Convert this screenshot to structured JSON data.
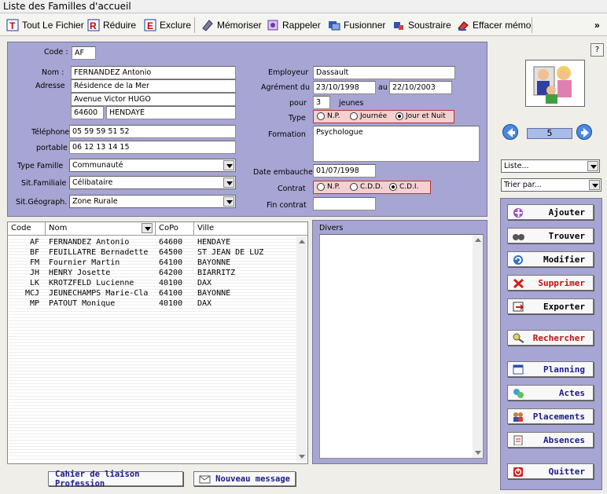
{
  "window": {
    "title": "Liste des Familles d'accueil"
  },
  "toolbar": {
    "items": [
      {
        "label": "Tout Le Fichier",
        "icon": "all-file-icon"
      },
      {
        "label": "Réduire",
        "icon": "reduce-icon"
      },
      {
        "label": "Exclure",
        "icon": "exclude-icon"
      },
      {
        "label": "Mémoriser",
        "icon": "memorize-icon"
      },
      {
        "label": "Rappeler",
        "icon": "recall-icon"
      },
      {
        "label": "Fusionner",
        "icon": "merge-icon"
      },
      {
        "label": "Soustraire",
        "icon": "subtract-icon"
      },
      {
        "label": "Effacer mémo",
        "icon": "erase-memo-icon"
      }
    ],
    "overflow": "»"
  },
  "form": {
    "code_label": "Code :",
    "code": "AF",
    "nom_label": "Nom :",
    "nom": "FERNANDEZ Antonio",
    "adresse_label": "Adresse",
    "adresse1": "Résidence de la Mer",
    "adresse2": "Avenue Victor HUGO",
    "cp": "64600",
    "ville": "HENDAYE",
    "telephone_label": "Téléphone",
    "telephone": "05 59 59 51 52",
    "portable_label": "portable",
    "portable": "06 12 13 14 15",
    "type_famille_label": "Type Famille",
    "type_famille": "Communauté",
    "sit_familiale_label": "Sit.Familiale",
    "sit_familiale": "Célibataire",
    "sit_geo_label": "Sit.Géograph.",
    "sit_geo": "Zone Rurale",
    "employeur_label": "Employeur",
    "employeur": "Dassault",
    "agrement_label": "Agrément du",
    "agrement_from": "23/10/1998",
    "au_label": "au",
    "agrement_to": "22/10/2003",
    "pour_label": "pour",
    "pour": "3",
    "jeunes_label": "jeunes",
    "type_label": "Type",
    "type_options": [
      "N.P.",
      "Journée",
      "Jour et Nuit"
    ],
    "type_selected": "Jour et Nuit",
    "formation_label": "Formation",
    "formation": "Psychologue",
    "date_embauche_label": "Date embauche",
    "date_embauche": "01/07/1998",
    "contrat_label": "Contrat",
    "contrat_options": [
      "N.P.",
      "C.D.D.",
      "C.D.I."
    ],
    "contrat_selected": "C.D.I.",
    "fin_contrat_label": "Fin contrat",
    "fin_contrat": ""
  },
  "navigator": {
    "record": "5"
  },
  "side": {
    "liste_label": "Liste...",
    "trier_label": "Trier par...",
    "help_label": "?"
  },
  "grid": {
    "columns": [
      "Code",
      "Nom",
      "CoPo",
      "Ville"
    ],
    "rows": [
      [
        "AF",
        "FERNANDEZ Antonio",
        "64600",
        "HENDAYE"
      ],
      [
        "BF",
        "FEUILLATRE Bernadette",
        "64500",
        "ST JEAN DE LUZ"
      ],
      [
        "FM",
        "Fournier Martin",
        "64100",
        "BAYONNE"
      ],
      [
        "JH",
        "HENRY Josette",
        "64200",
        "BIARRITZ"
      ],
      [
        "LK",
        "KROTZFELD Lucienne",
        "40100",
        "DAX"
      ],
      [
        "MCJ",
        "JEUNECHAMPS Marie-Cla",
        "64100",
        "BAYONNE"
      ],
      [
        "MP",
        "PATOUT Monique",
        "40100",
        "DAX"
      ]
    ]
  },
  "divers": {
    "label": "Divers",
    "text": ""
  },
  "buttons": {
    "ajouter": "Ajouter",
    "trouver": "Trouver",
    "modifier": "Modifier",
    "supprimer": "Supprimer",
    "exporter": "Exporter",
    "rechercher": "Rechercher",
    "planning": "Planning",
    "actes": "Actes",
    "placements": "Placements",
    "absences": "Absences",
    "quitter": "Quitter",
    "cahier": "Cahier de liaison Profession",
    "nouveau_message": "Nouveau message"
  }
}
